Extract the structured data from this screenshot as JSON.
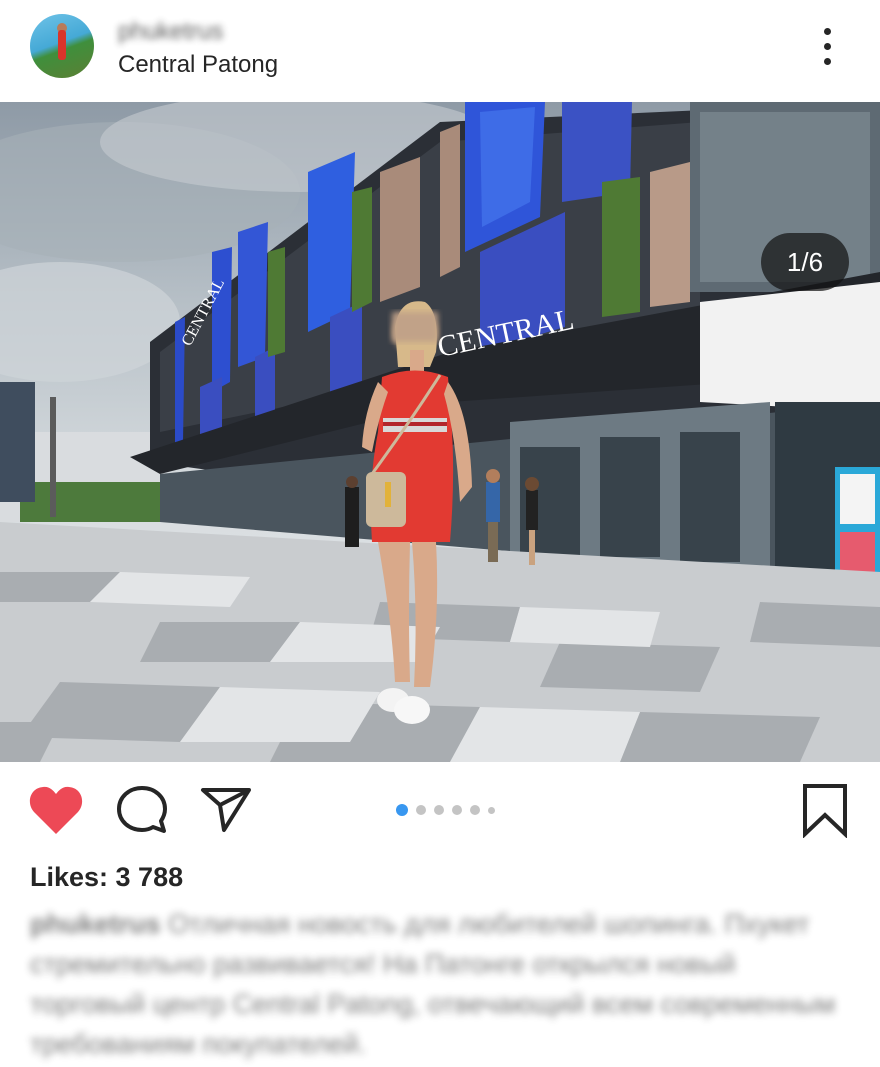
{
  "post_header": {
    "username": "phuketrus",
    "location": "Central Patong"
  },
  "photo": {
    "counter": "1/6",
    "signs": {
      "main_sign": "CENTRAL",
      "side_sign": "CENTRAL"
    }
  },
  "carousel": {
    "total": 6,
    "active_index": 0
  },
  "engagement": {
    "liked": true,
    "likes": "Likes: 3 788"
  },
  "caption": {
    "username": "phuketrus",
    "text": "Отличная новость для любителей шопинга. Пхукет стремительно развивается! На Патонге открылся новый торговый центр Central Patong, отвечающий всем современным требованиям покупателей."
  },
  "colors": {
    "heart": "#ed4956",
    "active_dot": "#3897f0",
    "inactive_dot": "#c4c4c4",
    "text": "#262626"
  },
  "icons": [
    "more-vertical-icon",
    "heart-icon",
    "comment-icon",
    "share-icon",
    "bookmark-icon"
  ]
}
